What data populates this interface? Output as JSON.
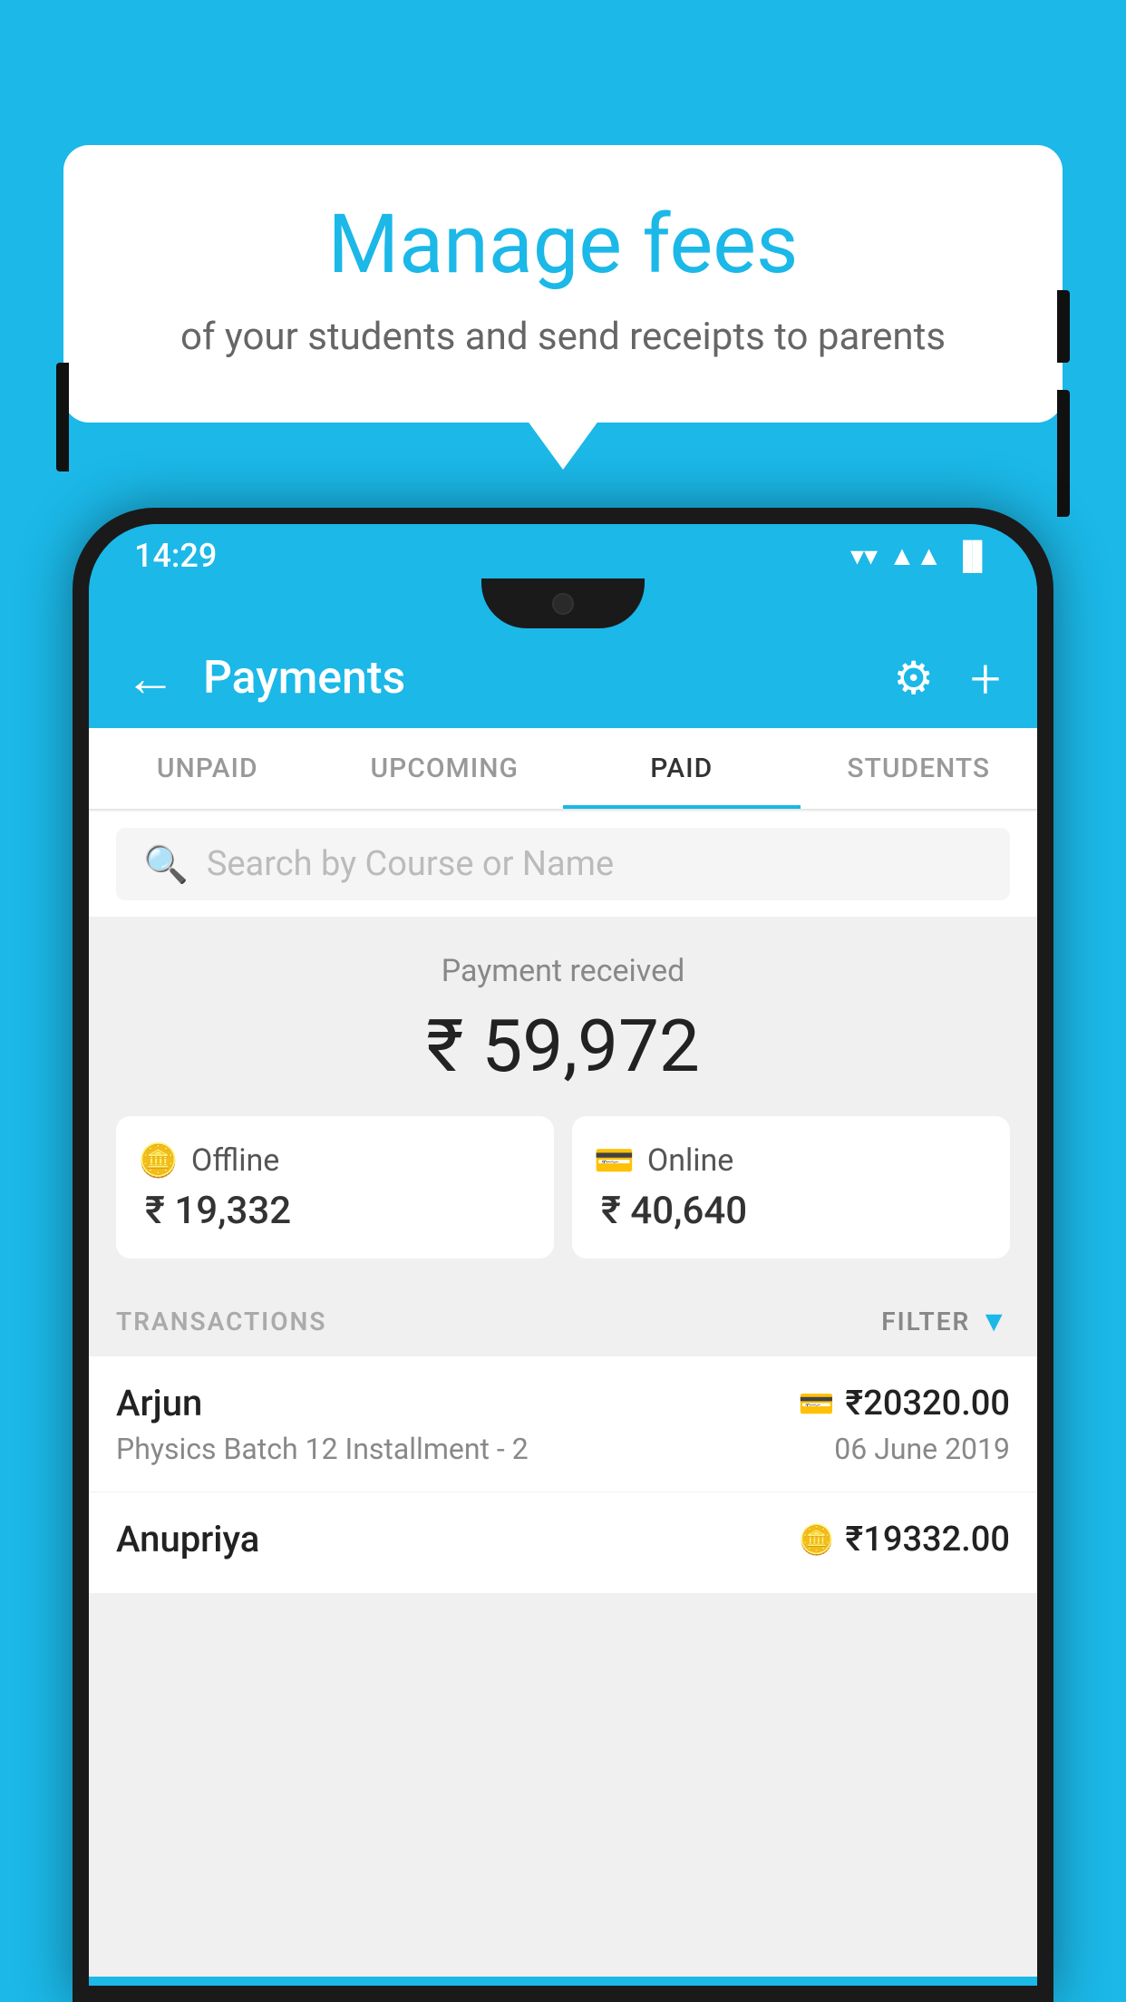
{
  "background_color": "#1BB8E8",
  "speech_bubble": {
    "title": "Manage fees",
    "subtitle": "of your students and send receipts to parents"
  },
  "status_bar": {
    "time": "14:29",
    "wifi_icon": "▼",
    "signal_icon": "▲",
    "battery_icon": "▐"
  },
  "header": {
    "title": "Payments",
    "back_label": "←",
    "settings_label": "⚙",
    "add_label": "+"
  },
  "tabs": [
    {
      "label": "UNPAID",
      "active": false
    },
    {
      "label": "UPCOMING",
      "active": false
    },
    {
      "label": "PAID",
      "active": true
    },
    {
      "label": "STUDENTS",
      "active": false
    }
  ],
  "search": {
    "placeholder": "Search by Course or Name"
  },
  "payment_summary": {
    "label": "Payment received",
    "amount": "₹ 59,972",
    "offline": {
      "type": "Offline",
      "amount": "₹ 19,332"
    },
    "online": {
      "type": "Online",
      "amount": "₹ 40,640"
    }
  },
  "transactions": {
    "label": "TRANSACTIONS",
    "filter_label": "FILTER",
    "items": [
      {
        "name": "Arjun",
        "pay_type": "card",
        "amount": "₹20320.00",
        "course": "Physics Batch 12 Installment - 2",
        "date": "06 June 2019"
      },
      {
        "name": "Anupriya",
        "pay_type": "cash",
        "amount": "₹19332.00",
        "course": "",
        "date": ""
      }
    ]
  }
}
